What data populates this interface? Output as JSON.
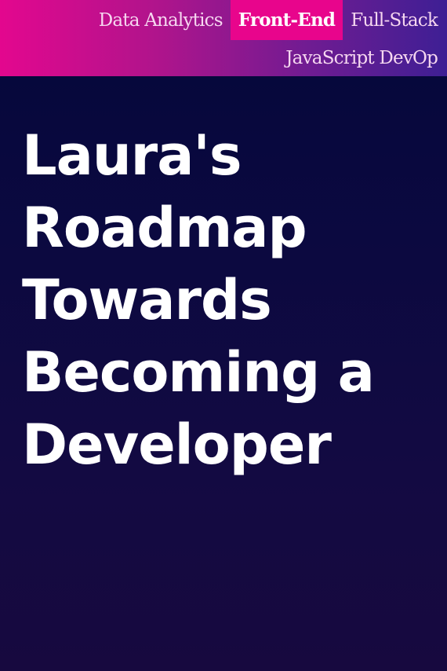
{
  "nav": {
    "items": [
      {
        "label": "Data Analytics",
        "active": false
      },
      {
        "label": "Front-End",
        "active": true
      },
      {
        "label": "Full-Stack",
        "active": false
      },
      {
        "label": "JavaScript DevOp",
        "active": false
      }
    ]
  },
  "hero": {
    "title_lines": [
      "Laura's",
      "Roadmap",
      "Towards",
      "Becoming a",
      "Developer"
    ]
  },
  "colors": {
    "nav_gradient": [
      "#e3078e",
      "#b0148c",
      "#6e1c92",
      "#3e1f94"
    ],
    "active_tab": "#e8058c",
    "background_top": "#04073a",
    "background_bottom": "#17093f",
    "title": "#ffffff",
    "nav_text": "#f6d7f0"
  }
}
